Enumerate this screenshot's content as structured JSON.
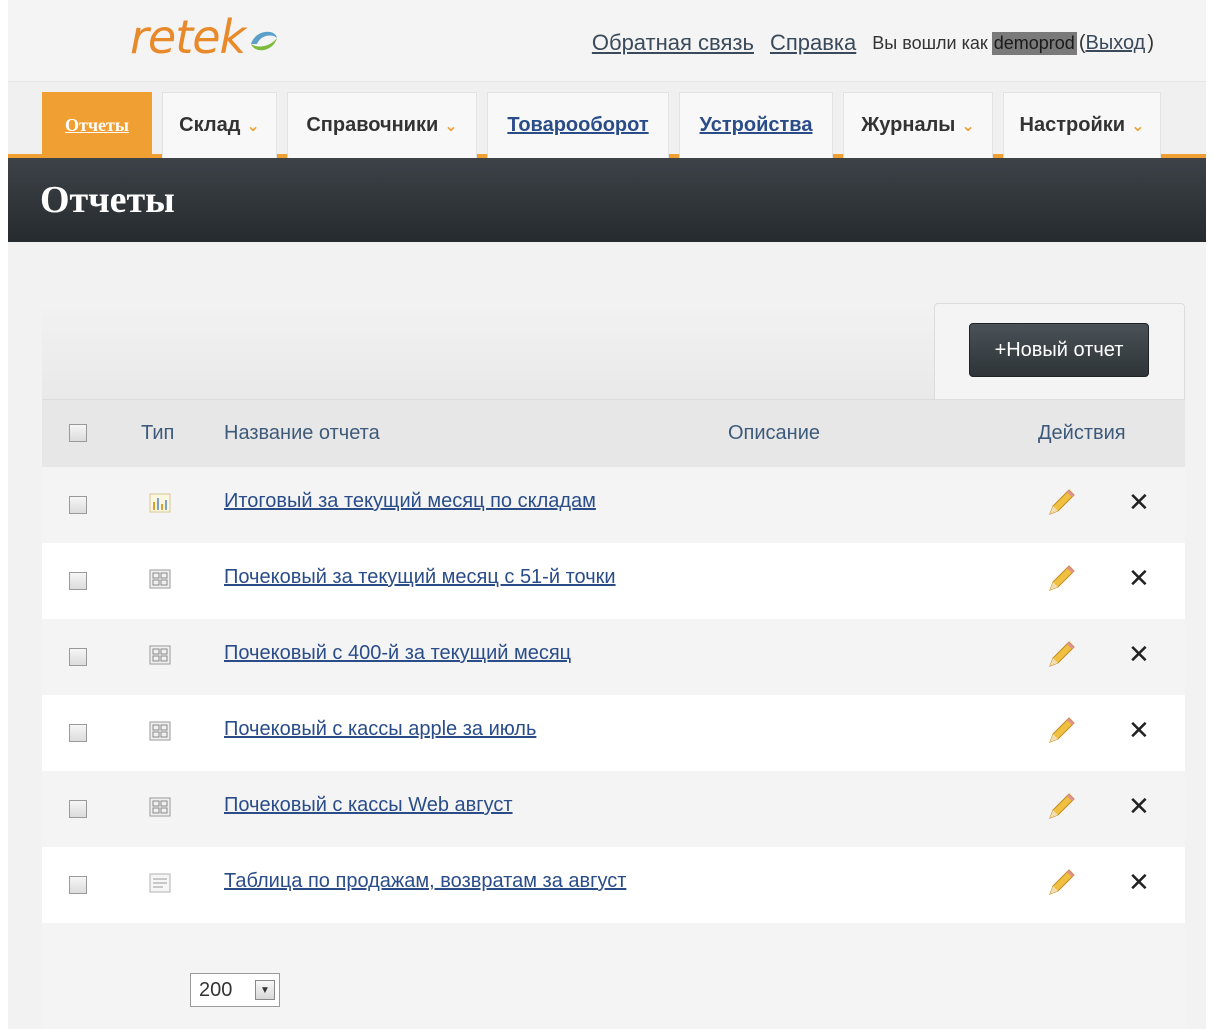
{
  "header": {
    "logo": "retek",
    "feedback_link": "Обратная связь",
    "help_link": "Справка",
    "logged_in_as": "Вы вошли как",
    "username": "demoprod",
    "logout_link": "Выход"
  },
  "nav": {
    "tabs": [
      {
        "label": "Отчеты",
        "active": true,
        "dropdown": false
      },
      {
        "label": "Склад",
        "active": false,
        "dropdown": true
      },
      {
        "label": "Справочники",
        "active": false,
        "dropdown": true
      },
      {
        "label": "Товарооборот",
        "active": false,
        "dropdown": false
      },
      {
        "label": "Устройства",
        "active": false,
        "dropdown": false
      },
      {
        "label": "Журналы",
        "active": false,
        "dropdown": true
      },
      {
        "label": "Настройки",
        "active": false,
        "dropdown": true
      }
    ]
  },
  "page": {
    "title": "Отчеты",
    "new_report_button": "+Новый отчет"
  },
  "table": {
    "columns": {
      "type": "Тип",
      "name": "Название отчета",
      "description": "Описание",
      "actions": "Действия"
    },
    "rows": [
      {
        "type_icon": "chart-icon",
        "name": "Итоговый за текущий месяц по складам",
        "description": ""
      },
      {
        "type_icon": "grid-icon",
        "name": "Почековый за текущий месяц с 51-й точки",
        "description": ""
      },
      {
        "type_icon": "grid-icon",
        "name": "Почековый с 400-й за текущий месяц",
        "description": ""
      },
      {
        "type_icon": "grid-icon",
        "name": "Почековый с кассы apple за июль",
        "description": ""
      },
      {
        "type_icon": "grid-icon",
        "name": "Почековый с кассы Web август",
        "description": ""
      },
      {
        "type_icon": "list-icon",
        "name": "Таблица по продажам, возвратам за август",
        "description": ""
      }
    ],
    "delete_symbol": "✕"
  },
  "pager": {
    "page_size": "200"
  },
  "colors": {
    "accent": "#f0a033",
    "titlebar": "#2f3539",
    "link": "#2a4d8a"
  }
}
